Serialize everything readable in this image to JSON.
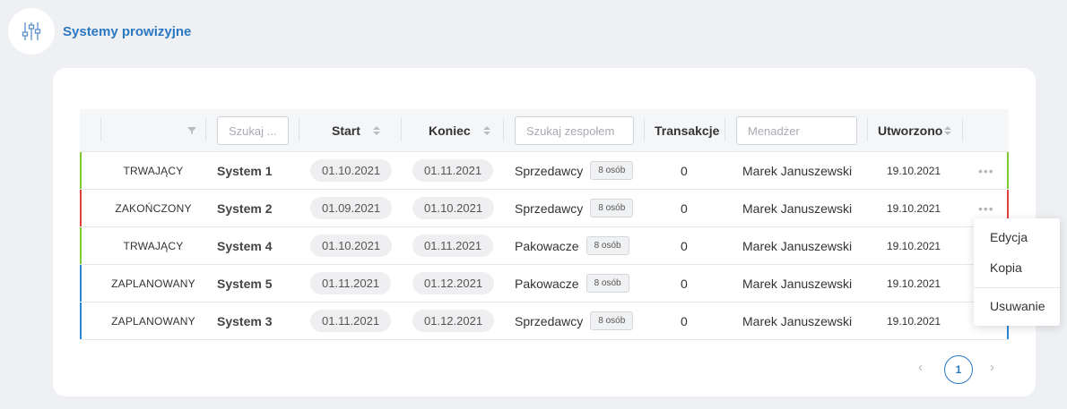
{
  "header": {
    "title": "Systemy prowizyjne",
    "icon": "sliders-icon"
  },
  "table": {
    "columns": {
      "search_name_placeholder": "Szukaj ...",
      "start": "Start",
      "end": "Koniec",
      "search_team_placeholder": "Szukaj zespołem",
      "transactions": "Transakcje",
      "manager_placeholder": "Menadżer",
      "created": "Utworzono"
    },
    "rows": [
      {
        "status": "TRWAJĄCY",
        "status_color": "#7ec832",
        "name": "System 1",
        "start": "01.10.2021",
        "end": "01.11.2021",
        "team": "Sprzedawcy",
        "team_size": "8 osób",
        "transactions": "0",
        "manager": "Marek Januszewski",
        "created": "19.10.2021"
      },
      {
        "status": "ZAKOŃCZONY",
        "status_color": "#e0403f",
        "name": "System 2",
        "start": "01.09.2021",
        "end": "01.10.2021",
        "team": "Sprzedawcy",
        "team_size": "8 osób",
        "transactions": "0",
        "manager": "Marek Januszewski",
        "created": "19.10.2021"
      },
      {
        "status": "TRWAJĄCY",
        "status_color": "#7ec832",
        "name": "System 4",
        "start": "01.10.2021",
        "end": "01.11.2021",
        "team": "Pakowacze",
        "team_size": "8 osób",
        "transactions": "0",
        "manager": "Marek Januszewski",
        "created": "19.10.2021"
      },
      {
        "status": "ZAPLANOWANY",
        "status_color": "#2b86d6",
        "name": "System 5",
        "start": "01.11.2021",
        "end": "01.12.2021",
        "team": "Pakowacze",
        "team_size": "8 osób",
        "transactions": "0",
        "manager": "Marek Januszewski",
        "created": "19.10.2021"
      },
      {
        "status": "ZAPLANOWANY",
        "status_color": "#2b86d6",
        "name": "System 3",
        "start": "01.11.2021",
        "end": "01.12.2021",
        "team": "Sprzedawcy",
        "team_size": "8 osób",
        "transactions": "0",
        "manager": "Marek Januszewski",
        "created": "19.10.2021"
      }
    ]
  },
  "context_menu": {
    "edit": "Edycja",
    "copy": "Kopia",
    "delete": "Usuwanie"
  },
  "pagination": {
    "current_page": "1",
    "prev_icon": "chevron-left-icon",
    "next_icon": "chevron-right-icon"
  },
  "colors": {
    "accent": "#2b78c2",
    "ongoing": "#7ec832",
    "finished": "#e0403f",
    "planned": "#2b86d6"
  }
}
